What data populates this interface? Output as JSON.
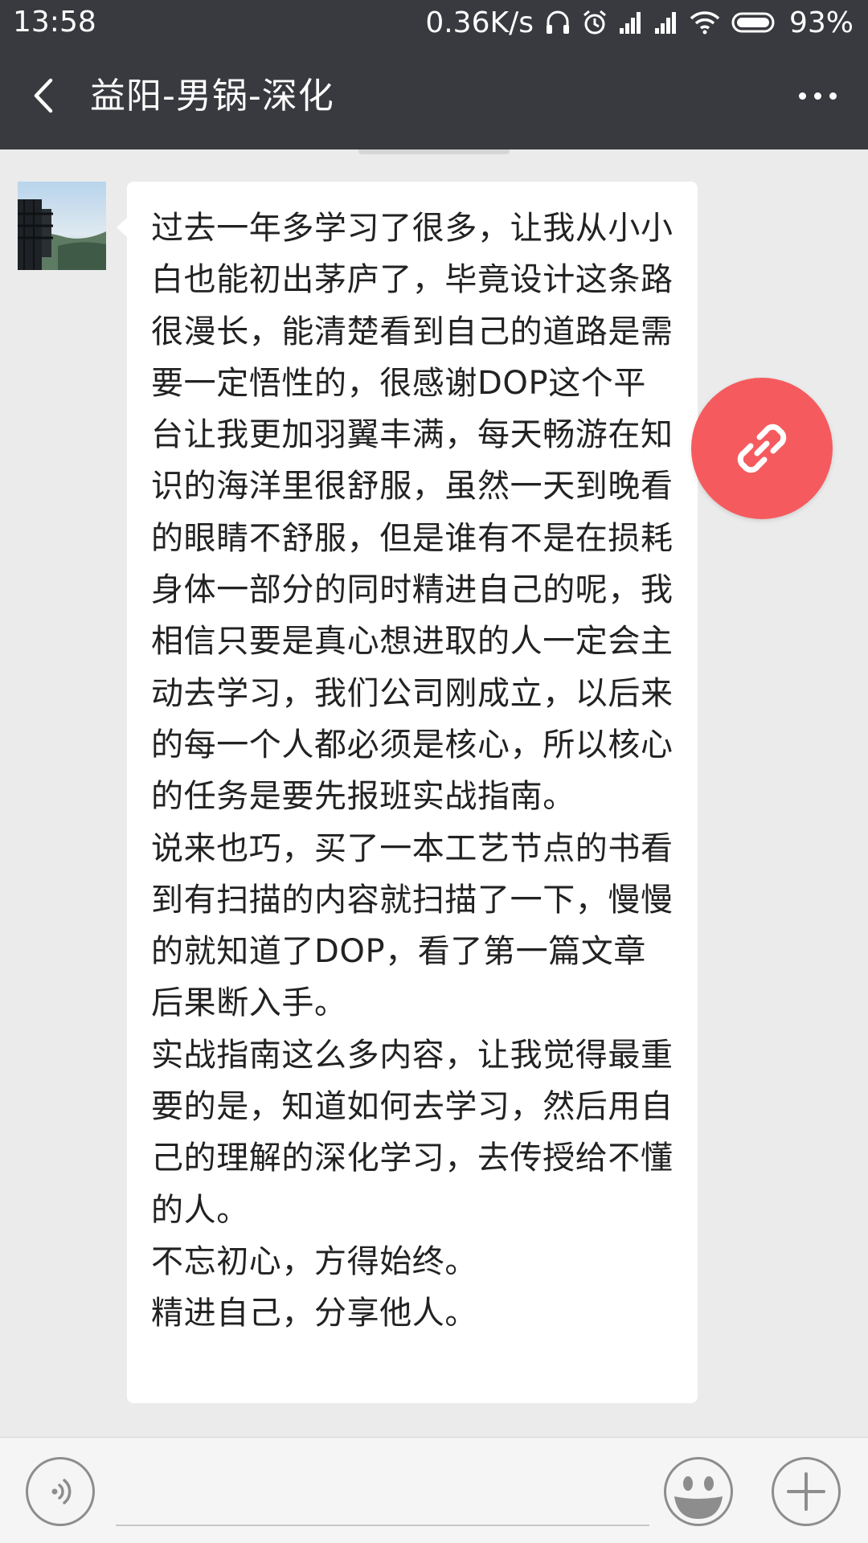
{
  "status_bar": {
    "time": "13:58",
    "network_speed": "0.36K/s",
    "battery_percent": "93%",
    "icons": [
      "headset-icon",
      "alarm-icon",
      "signal-icon",
      "signal-icon",
      "wifi-icon",
      "battery-icon"
    ]
  },
  "header": {
    "title": "益阳-男锅-深化",
    "back_icon": "chevron-left-icon",
    "more_icon": "more-dots-icon"
  },
  "message": {
    "sender_avatar": "avatar",
    "paragraphs": [
      "过去一年多学习了很多，让我从小小白也能初出茅庐了，毕竟设计这条路很漫长，能清楚看到自己的道路是需要一定悟性的，很感谢DOP这个平台让我更加羽翼丰满，每天畅游在知识的海洋里很舒服，虽然一天到晚看的眼睛不舒服，但是谁有不是在损耗身体一部分的同时精进自己的呢，我相信只要是真心想进取的人一定会主动去学习，我们公司刚成立，以后来的每一个人都必须是核心，所以核心的任务是要先报班实战指南。",
      "说来也巧，买了一本工艺节点的书看到有扫描的内容就扫描了一下，慢慢的就知道了DOP，看了第一篇文章后果断入手。",
      "实战指南这么多内容，让我觉得最重要的是，知道如何去学习，然后用自己的理解的深化学习，去传授给不懂的人。",
      "不忘初心，方得始终。",
      "精进自己，分享他人。"
    ]
  },
  "floating_button": {
    "icon": "link-icon",
    "color": "#f55b5e"
  },
  "input_bar": {
    "voice_icon": "voice-icon",
    "input_value": "",
    "emoji_icon": "emoji-icon",
    "plus_icon": "plus-icon"
  },
  "colors": {
    "header_bg": "#393a3f",
    "chat_bg": "#ebebeb",
    "bubble_bg": "#ffffff",
    "accent_red": "#f55b5e"
  }
}
